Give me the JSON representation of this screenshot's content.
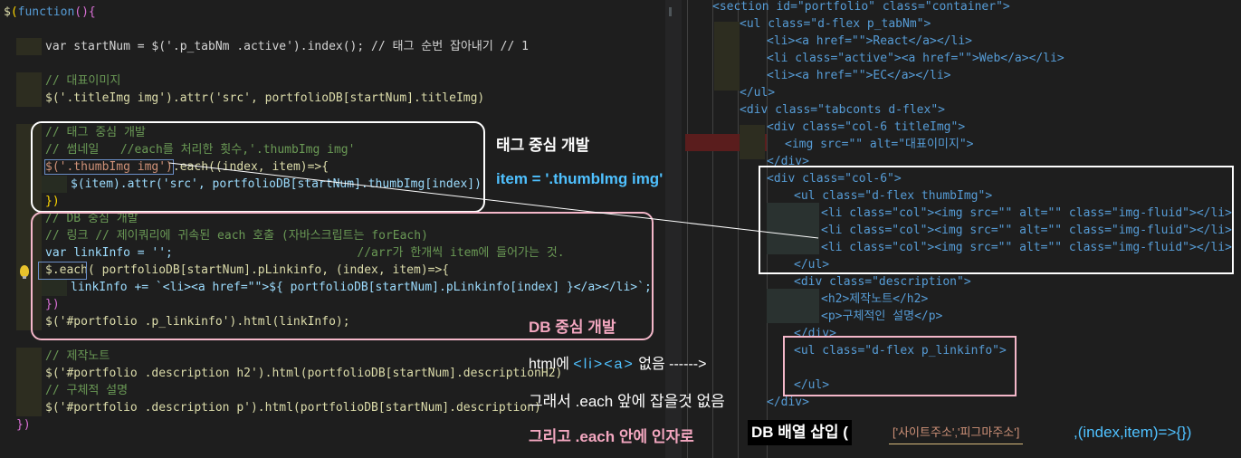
{
  "left_code": {
    "l1": "$(function(){",
    "l3": "var startNum = $('.p_tabNm .active').index(); // 태그 순번 잡아내기 // 1",
    "l5": "// 대표이미지",
    "l6": "$('.titleImg img').attr('src', portfolioDB[startNum].titleImg)",
    "l8": "// 태그 중심 개발",
    "l9": "// 썸네일   //each를 처리한 횟수,'.thumbImg img'",
    "l10a": "$('.thumbImg img')",
    "l10b": ".each((index, item)=>{",
    "l11": "$(item).attr('src', portfolioDB[startNum].thumbImg[index])",
    "l12": "})",
    "l13": "// DB 중심 개발",
    "l14": "// 링크 // 제이쿼리에 귀속된 each 호출 (자바스크립트는 forEach)",
    "l15a": "var linkInfo = '';",
    "l15b": "//arr가 한개씩 item에 들어가는 것.",
    "l16": "$.each( portfolioDB[startNum].pLinkinfo, (index, item)=>{",
    "l17": "linkInfo += `<li><a href=\"\">${ portfolioDB[startNum].pLinkinfo[index] }</a></li>`;",
    "l18": "})",
    "l19": "$('#portfolio .p_linkinfo').html(linkInfo);",
    "l21": "// 제작노트",
    "l22": "$('#portfolio .description h2').html(portfolioDB[startNum].descriptionH2)",
    "l23": "// 구체적 설명",
    "l24": "$('#portfolio .description p').html(portfolioDB[startNum].description)",
    "l25": "})"
  },
  "right_code": {
    "r1": "<section id=\"portfolio\" class=\"container\">",
    "r2": "<ul class=\"d-flex p_tabNm\">",
    "r3": "<li><a href=\"\">React</a></li>",
    "r4": "<li class=\"active\"><a href=\"\">Web</a></li>",
    "r5": "<li><a href=\"\">EC</a></li>",
    "r6": "</ul>",
    "r7": "<div class=\"tabconts d-flex\">",
    "r8": "<div class=\"col-6 titleImg\">",
    "r9": "<img src=\"\" alt=\"대표이미지\">",
    "r10": "</div>",
    "r11": "<div class=\"col-6\">",
    "r12": "<ul class=\"d-flex thumbImg\">",
    "r13": "<li class=\"col\"><img src=\"\" alt=\"\" class=\"img-fluid\"></li>",
    "r14": "<li class=\"col\"><img src=\"\" alt=\"\" class=\"img-fluid\"></li>",
    "r15": "<li class=\"col\"><img src=\"\" alt=\"\" class=\"img-fluid\"></li>",
    "r16": "</ul>",
    "r17": "<div class=\"description\">",
    "r18": "<h2>제작노트</h2>",
    "r19": "<p>구체적인 설명</p>",
    "r20": "</div>",
    "r21": "<ul class=\"d-flex p_linkinfo\">",
    "r23": "</ul>",
    "r24": "</div>",
    "r25": "</div>"
  },
  "annotations": {
    "tag_dev": "태그 중심 개발",
    "item_eq": "item = '.thumbImg img'",
    "db_dev": "DB 중심 개발",
    "html_li_a_prefix": "html에",
    "html_li_a_tags": "<li><a>",
    "html_li_a_suffix": "없음 ------>",
    "so_each": "그래서 .each 앞에 잡을것 없음",
    "and_each": "그리고 .each 안에 인자로",
    "db_insert": "DB 배열 삽입 (",
    "array_sample": "['사이트주소','피그마주소']",
    "args_tail": ",(index,item)=>{})"
  },
  "colors": {
    "background": "#1e1e1e",
    "white_box": "#ffffff",
    "pink_box": "#f4b7c9",
    "annotation_white": "#ffffff",
    "annotation_blue": "#4fc1ff",
    "annotation_pink": "#f4a7c0",
    "annotation_orange": "#ce9178"
  }
}
